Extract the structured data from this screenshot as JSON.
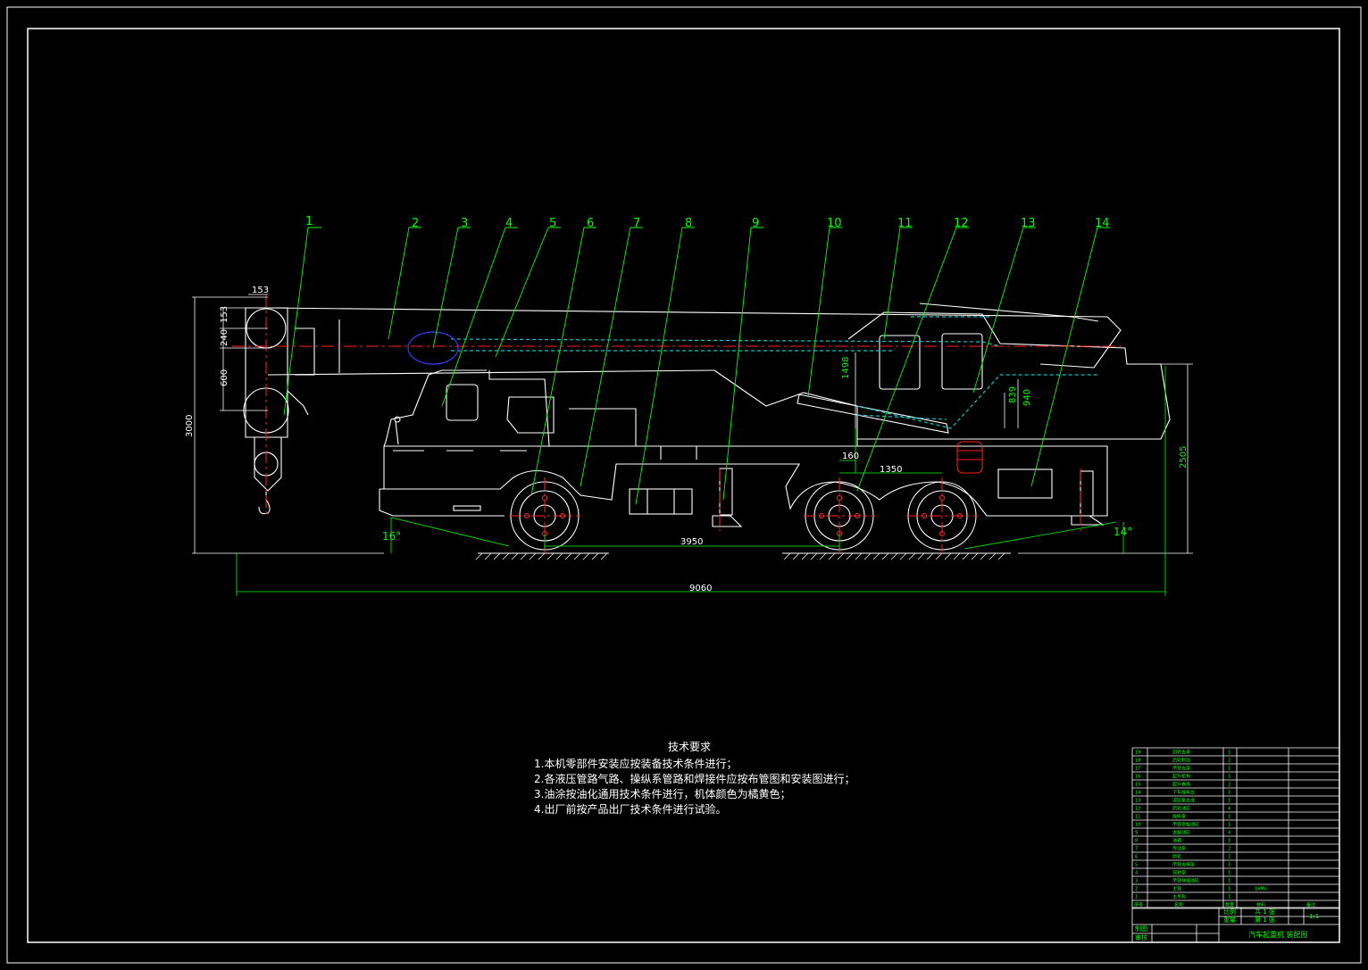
{
  "drawing": {
    "title_block_name": "汽车起重机 装配图",
    "scale": "1:1"
  },
  "callouts": [
    "1",
    "2",
    "3",
    "4",
    "5",
    "6",
    "7",
    "8",
    "9",
    "10",
    "11",
    "12",
    "13",
    "14"
  ],
  "dimensions": {
    "d153_top": "153",
    "d153_side": "153",
    "d240": "240",
    "d600": "600",
    "d3000": "3000",
    "d1498": "1498",
    "d839": "839",
    "d940": "940",
    "d160": "160",
    "d1350": "1350",
    "d2505": "2505",
    "d3950": "3950",
    "d9060": "9060",
    "angle_left": "16°",
    "angle_right": "14°"
  },
  "tech_requirements": {
    "title": "技术要求",
    "items": [
      "1.本机零部件安装应按装备技术条件进行；",
      "2.各液压管路气路、操纵系管路和焊接件应按布管图和安装图进行；",
      "3.油涂按油化通用技术条件进行，机体颜色为橘黄色；",
      "4.出厂前按产品出厂技术条件进行试验。"
    ]
  },
  "parts_table": {
    "rows": [
      {
        "no": "19",
        "name": "回转支承",
        "qty": "1"
      },
      {
        "no": "18",
        "name": "后轮制动",
        "qty": "2"
      },
      {
        "no": "17",
        "name": "吊臂支架",
        "qty": "1"
      },
      {
        "no": "16",
        "name": "起升机构",
        "qty": "1"
      },
      {
        "no": "15",
        "name": "起升卷扬",
        "qty": "2"
      },
      {
        "no": "14",
        "name": "下车操纵台",
        "qty": "1"
      },
      {
        "no": "13",
        "name": "液压泵总成",
        "qty": "1"
      },
      {
        "no": "12",
        "name": "后轮油缸",
        "qty": "4"
      },
      {
        "no": "11",
        "name": "操纵室",
        "qty": "1"
      },
      {
        "no": "10",
        "name": "吊臂变幅油缸",
        "qty": "1"
      },
      {
        "no": "9",
        "name": "支腿油缸",
        "qty": "4"
      },
      {
        "no": "8",
        "name": "油箱",
        "qty": "1"
      },
      {
        "no": "7",
        "name": "传动系",
        "qty": "2"
      },
      {
        "no": "6",
        "name": "前轮",
        "qty": "2"
      },
      {
        "no": "5",
        "name": "吊臂支撑架",
        "qty": "1"
      },
      {
        "no": "4",
        "name": "驾驶室",
        "qty": "1"
      },
      {
        "no": "3",
        "name": "吊臂伸缩油缸",
        "qty": "1"
      },
      {
        "no": "2",
        "name": "主臂",
        "qty": "1",
        "material": "16Mn"
      },
      {
        "no": "1",
        "name": "主吊钩",
        "qty": "1"
      }
    ],
    "header": {
      "no": "序号",
      "name": "名称",
      "qty": "数量",
      "material": "材料",
      "remark": "备注"
    },
    "block": {
      "scale_label": "比例",
      "sheet_total": "共 1 张",
      "weight_label": "重量",
      "sheet_no": "第 1 张",
      "scale_value": "1:1",
      "drawn_label": "制图",
      "checked_label": "审核"
    },
    "colors": {
      "lines": "#ffffff",
      "text": "#00ff00"
    }
  },
  "colors": {
    "background": "#000000",
    "outline": "#ffffff",
    "leader": "#00ff00",
    "centerline": "#ff0000",
    "hydraulic": "#00c8c8",
    "detail_blue": "#3a3aff"
  }
}
